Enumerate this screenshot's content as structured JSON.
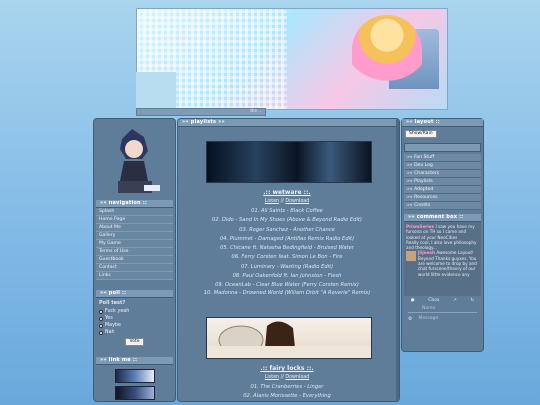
{
  "banner": {
    "label": "the ..."
  },
  "left": {
    "navigation": {
      "header": "»» navigation ::",
      "items": [
        "Splash",
        "Home Page",
        "About Me",
        "Gallery",
        "My Game",
        "Terms of Use",
        "Guestbook",
        "Contact",
        "Links"
      ]
    },
    "poll": {
      "header": "»» poll ::",
      "question": "Poll test?",
      "options": [
        "Fuck yeah",
        "Yes",
        "Maybe",
        "Nah"
      ],
      "vote_label": "Vote"
    },
    "link_me": {
      "header": "»» link me ::"
    }
  },
  "center": {
    "header": "»» playlists »»",
    "wetware": {
      "title": ".:: wetware ::.",
      "links": {
        "listen": "Listen",
        "sep": " // ",
        "download": "Download"
      },
      "tracks": [
        "01. All Saints - Black Coffee",
        "02. Dido - Sand In My Shoes (Above & Beyond Radio Edit)",
        "03. Roger Sanchez - Another Chance",
        "04. Plummet - Damaged (Antillas Remix Radio Edit)",
        "05. Chicane ft. Natasha Bedingfield - Bruised Water",
        "06. Ferry Corsten feat. Simon Le Bon - Fire",
        "07. Luminary - Wasting (Radio Edit)",
        "08. Paul Oakenfold ft. Ian Johnston - Flesh",
        "09. OceanLab - Clear Blue Water (Ferry Corsten Remix)",
        "10. Madonna - Drowned World (Wiliam Orbit \"A Reverie\" Remix)"
      ]
    },
    "fairy_locks": {
      "title": ".:: fairy locks ::.",
      "links": {
        "listen": "Listen",
        "sep": " // ",
        "download": "Download"
      },
      "tracks": [
        "01. The Cranberries - Linger",
        "02. Alanis Morissette - Everything"
      ]
    }
  },
  "right": {
    "layout": {
      "header": "»» layout ::",
      "toggle_label": "Show/Rain"
    },
    "links": {
      "items": [
        "»» Fan Stuff",
        "»» Dev Log",
        "»» Characters",
        "»» Playlists",
        "»» Adopted",
        "»» Resources",
        "»» Credits"
      ]
    },
    "comment_box": {
      "header": "»» comment box ::",
      "entries": [
        {
          "name": "PrismSeries",
          "text": "I saw you have my fursona on TH so I came and looked at your NeoCities"
        },
        {
          "name": "",
          "text": "Really cool, I also love philosophy and theology..."
        },
        {
          "name": "Jiijeesh",
          "text": "Awesome Layout! Beyond Thanks guyxes. You are welcome to drop by and chat furscene/theory of our world little evidence any"
        }
      ],
      "name_placeholder": "Name",
      "message_placeholder": "Message",
      "cbox_label": "Cbox"
    }
  },
  "colors": {
    "panel": "#5f7c98",
    "header": "#7d9ab5",
    "background": "#8fc3ea"
  }
}
